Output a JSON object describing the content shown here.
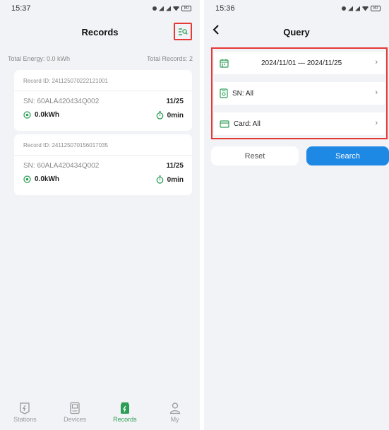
{
  "records_screen": {
    "status_time": "15:37",
    "battery": "80",
    "title": "Records",
    "total_energy": "Total Energy: 0.0 kWh",
    "total_records": "Total Records: 2",
    "records": [
      {
        "record_id": "Record ID: 241125070222121001",
        "sn": "SN: 60ALA420434Q002",
        "date": "11/25",
        "energy": "0.0kWh",
        "duration": "0min"
      },
      {
        "record_id": "Record ID: 241125070156017035",
        "sn": "SN: 60ALA420434Q002",
        "date": "11/25",
        "energy": "0.0kWh",
        "duration": "0min"
      }
    ],
    "nav": [
      {
        "label": "Stations",
        "icon": "stations-icon"
      },
      {
        "label": "Devices",
        "icon": "devices-icon"
      },
      {
        "label": "Records",
        "icon": "records-icon"
      },
      {
        "label": "My",
        "icon": "my-icon"
      }
    ],
    "active_nav": "Records"
  },
  "query_screen": {
    "status_time": "15:36",
    "battery": "80",
    "title": "Query",
    "date_range": "2024/11/01 — 2024/11/25",
    "sn_filter": "SN: All",
    "card_filter": "Card: All",
    "reset_label": "Reset",
    "search_label": "Search"
  },
  "colors": {
    "accent_green": "#2e9e57",
    "search_blue": "#1e88e5",
    "highlight_red": "#e53935"
  }
}
